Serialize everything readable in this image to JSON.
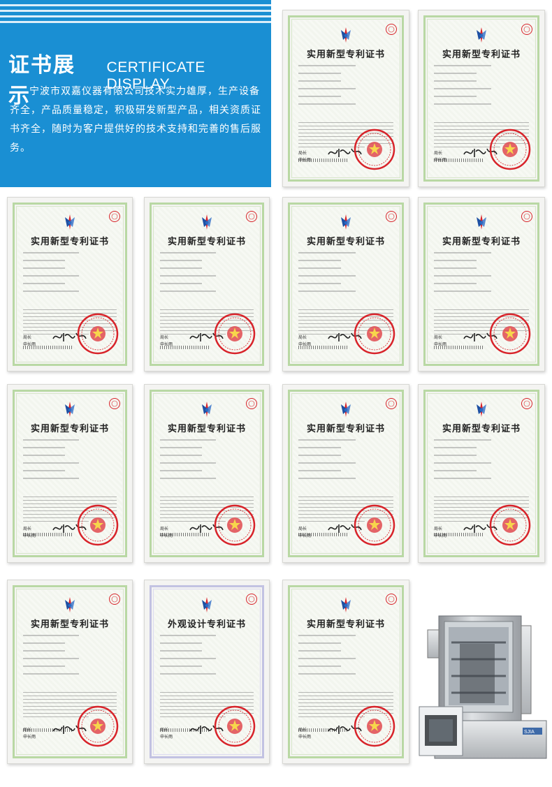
{
  "header": {
    "title": "证书展示",
    "subtitle": "CERTIFICATE DISPLAY",
    "description": "宁波市双嘉仪器有限公司技术实力雄厚，生产设备齐全，产品质量稳定，积极研发新型产品，相关资质证书齐全，随时为客户提供好的技术支持和完善的售后服务。",
    "bg_color": "#1a8fd3"
  },
  "certificates": [
    {
      "title": "实用新型专利证书",
      "kind": "utility"
    },
    {
      "title": "实用新型专利证书",
      "kind": "utility"
    },
    {
      "title": "实用新型专利证书",
      "kind": "utility"
    },
    {
      "title": "实用新型专利证书",
      "kind": "utility"
    },
    {
      "title": "实用新型专利证书",
      "kind": "utility"
    },
    {
      "title": "实用新型专利证书",
      "kind": "utility"
    },
    {
      "title": "实用新型专利证书",
      "kind": "utility"
    },
    {
      "title": "实用新型专利证书",
      "kind": "utility"
    },
    {
      "title": "实用新型专利证书",
      "kind": "utility"
    },
    {
      "title": "实用新型专利证书",
      "kind": "utility"
    },
    {
      "title": "实用新型专利证书",
      "kind": "utility"
    },
    {
      "title": "外观设计专利证书",
      "kind": "design"
    },
    {
      "title": "实用新型专利证书",
      "kind": "utility"
    }
  ],
  "cert_common": {
    "label_a": "局长",
    "label_b": "申长雨"
  },
  "product": {
    "icon": "freeze-dryer-image",
    "brand_mark": "SJIA"
  }
}
